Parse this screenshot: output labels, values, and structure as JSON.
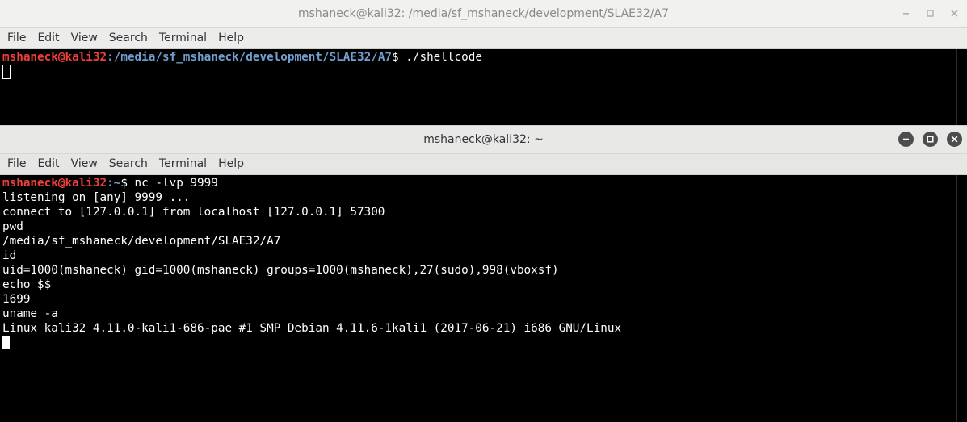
{
  "window1": {
    "title": "mshaneck@kali32: /media/sf_mshaneck/development/SLAE32/A7",
    "menu": [
      "File",
      "Edit",
      "View",
      "Search",
      "Terminal",
      "Help"
    ],
    "prompt_user": "mshaneck@kali32",
    "prompt_path": ":/media/sf_mshaneck/development/SLAE32/A7",
    "prompt_cmd": "$ ./shellcode"
  },
  "window2": {
    "title": "mshaneck@kali32: ~",
    "menu": [
      "File",
      "Edit",
      "View",
      "Search",
      "Terminal",
      "Help"
    ],
    "prompt_user": "mshaneck@kali32",
    "prompt_path": ":~",
    "prompt_cmd": "$ nc -lvp 9999",
    "output": [
      "listening on [any] 9999 ...",
      "connect to [127.0.0.1] from localhost [127.0.0.1] 57300",
      "pwd",
      "/media/sf_mshaneck/development/SLAE32/A7",
      "id",
      "uid=1000(mshaneck) gid=1000(mshaneck) groups=1000(mshaneck),27(sudo),998(vboxsf)",
      "echo $$",
      "1699",
      "uname -a",
      "Linux kali32 4.11.0-kali1-686-pae #1 SMP Debian 4.11.6-1kali1 (2017-06-21) i686 GNU/Linux"
    ]
  },
  "icons": {
    "minimize": "minimize-icon",
    "maximize": "maximize-icon",
    "close": "close-icon"
  }
}
